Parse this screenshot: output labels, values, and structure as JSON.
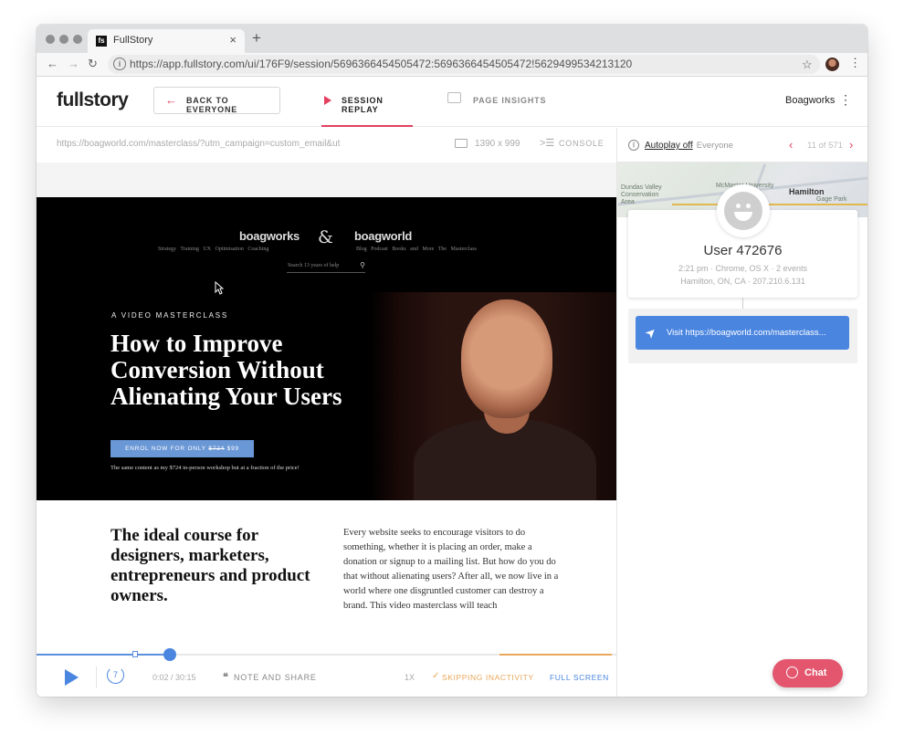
{
  "browser": {
    "tab_title": "FullStory",
    "tab_close": "×",
    "new_tab": "+",
    "url": "https://app.fullstory.com/ui/176F9/session/5696366454505472:5696366454505472!5629499534213120",
    "back": "←",
    "forward": "→",
    "reload": "↻",
    "star": "☆",
    "menu": "⋮"
  },
  "header": {
    "logo": "fullstory",
    "back_label": "BACK TO EVERYONE",
    "back_arrow": "←",
    "tabs": [
      {
        "label": "SESSION REPLAY",
        "active": true
      },
      {
        "label": "PAGE INSIGHTS",
        "active": false
      }
    ],
    "org_name": "Boagworks",
    "org_menu": "⋮"
  },
  "replay_bar": {
    "page_url": "https://boagworld.com/masterclass/?utm_campaign=custom_email&ut",
    "viewport": "1390 x 999",
    "console_icon": ">☰",
    "console_label": "CONSOLE"
  },
  "site": {
    "brand_a": "boagworks",
    "amp": "&",
    "brand_b": "boagworld",
    "nav_left": "Strategy  Training  UX Optimisation  Coaching",
    "nav_right": "Blog  Podcast  Books and More  The Masterclass",
    "search_placeholder": "Search 13 years of help",
    "search_icon": "⚲",
    "eyebrow": "A VIDEO MASTERCLASS",
    "hero_title": "How to Improve Conversion Without Alienating Your Users",
    "enrol_prefix": "ENROL NOW FOR ONLY ",
    "enrol_old_price": "$724",
    "enrol_new_price": " $99",
    "hero_note": "The same content as my $724 in-person workshop but at a fraction of the price!",
    "content_heading": "The ideal course for designers, marketers, entrepreneurs and product owners.",
    "content_body": "Every website seeks to encourage visitors to do something, whether it is placing an order, make a donation or signup to a mailing list. But how do you do that without alienating users? After all, we now live in a world where one disgruntled customer can destroy a brand. This video masterclass will teach"
  },
  "player": {
    "progress": 0.23,
    "rewind_label": "7",
    "time": "0:02 / 30:15",
    "note_icon": "❝",
    "note_label": "NOTE AND SHARE",
    "speed": "1X",
    "skip_icon": "✓",
    "skip_label": "SKIPPING INACTIVITY",
    "fullscreen_label": "FULL SCREEN"
  },
  "panel": {
    "autoplay_icon": "||",
    "autoplay_label": "Autoplay off",
    "autoplay_sub": "· Everyone",
    "prev": "‹",
    "count": "11 of 571",
    "next": "›",
    "map_labels": [
      "Dundas Valley Conservation Area",
      "McMaster University",
      "Hamilton",
      "Gage Park"
    ],
    "user_name": "User 472676",
    "meta_line1": "2:21 pm · Chrome, OS X · 2 events",
    "meta_line2": "Hamilton,  ON,  CA · 207.210.6.131",
    "event_icon": "➤",
    "event_label": "Visit https://boagworld.com/masterclass..."
  },
  "chat": {
    "label": "Chat"
  }
}
